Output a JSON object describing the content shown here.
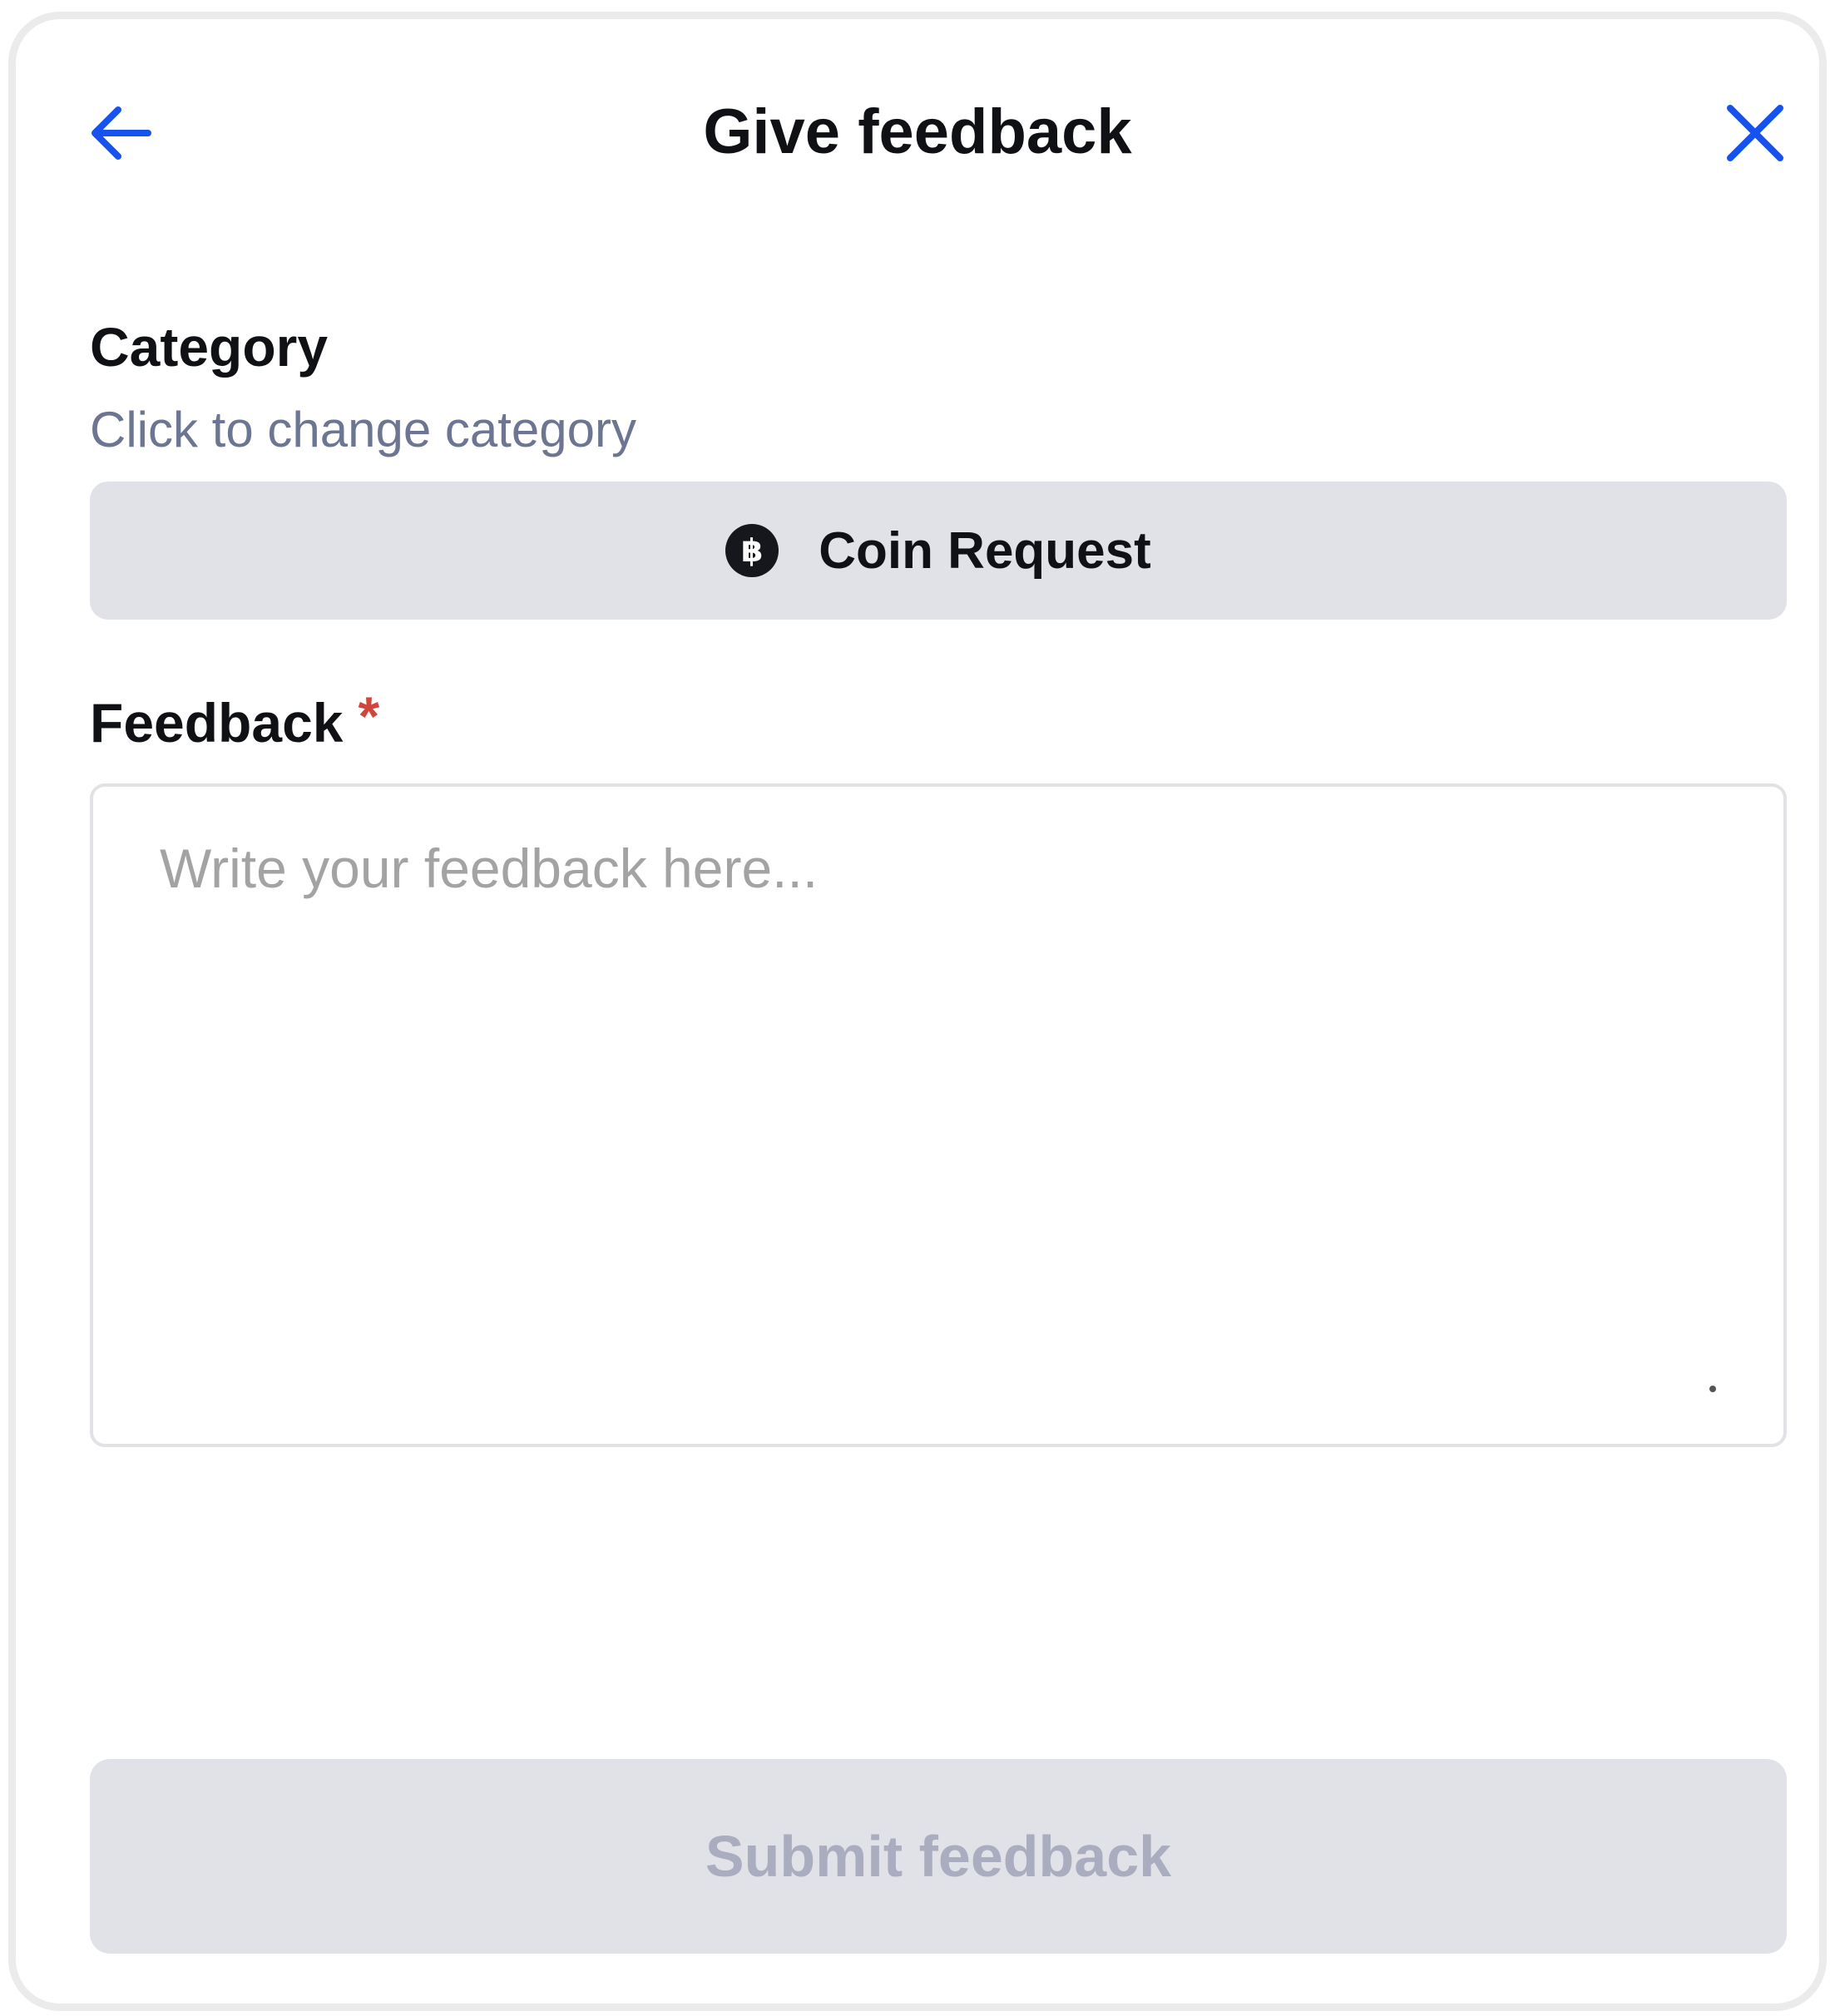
{
  "header": {
    "title": "Give feedback",
    "back_icon": "arrow-left-icon",
    "close_icon": "close-icon"
  },
  "category": {
    "label": "Category",
    "hint": "Click to change category",
    "selected": "Coin Request",
    "icon": "bitcoin-icon",
    "icon_glyph": "฿"
  },
  "feedback": {
    "label": "Feedback",
    "required_marker": "*",
    "placeholder": "Write your feedback here...",
    "value": ""
  },
  "submit": {
    "label": "Submit feedback",
    "enabled": false
  },
  "colors": {
    "accent": "#1652f0",
    "required": "#d1453b",
    "hint": "#6c7591",
    "button_bg": "#e1e2e7",
    "disabled_text": "#a9adbf"
  }
}
